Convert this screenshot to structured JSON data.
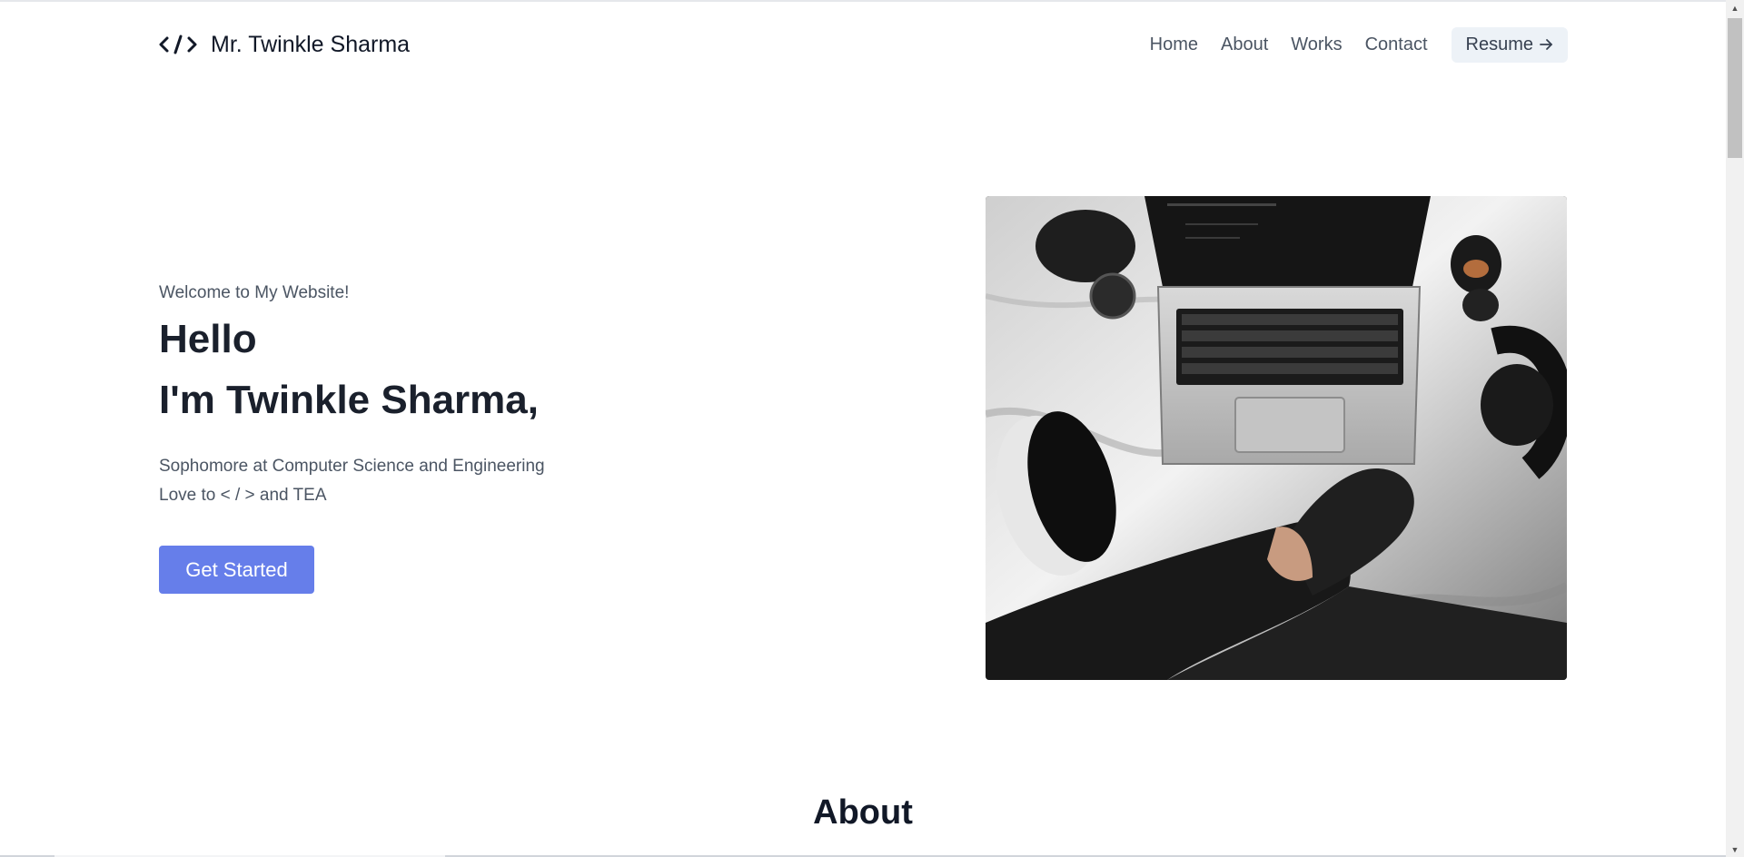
{
  "header": {
    "brand_name": "Mr. Twinkle Sharma",
    "nav": [
      "Home",
      "About",
      "Works",
      "Contact"
    ],
    "resume_label": "Resume"
  },
  "hero": {
    "welcome": "Welcome to My Website!",
    "hello": "Hello",
    "name": "I'm Twinkle Sharma,",
    "desc_line1": "Sophomore at Computer Science and Engineering",
    "desc_line2": "Love to < / > and TEA",
    "cta_label": "Get Started"
  },
  "about": {
    "heading": "About"
  },
  "colors": {
    "accent": "#667eea",
    "resume_bg": "#edf2f7",
    "heading_text": "#1a202c",
    "muted_text": "#4b5563"
  },
  "icons": {
    "brand": "code-icon",
    "resume_arrow": "arrow-right-icon"
  }
}
